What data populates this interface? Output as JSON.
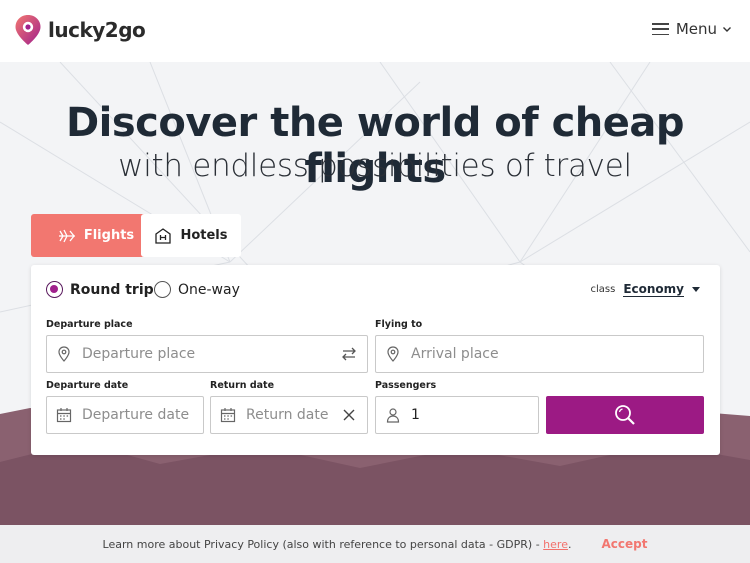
{
  "brand": {
    "name": "lucky2go",
    "accent": "#9c1a84",
    "coral": "#f27770"
  },
  "header": {
    "menu_label": "Menu"
  },
  "hero": {
    "headline": "Discover the world of cheap flights",
    "subline": "with endless possibilities of travel"
  },
  "tabs": [
    {
      "label": "Flights",
      "icon": "plane-icon",
      "active": true
    },
    {
      "label": "Hotels",
      "icon": "hotel-icon",
      "active": false
    }
  ],
  "search": {
    "trip_types": [
      {
        "label": "Round trip",
        "selected": true
      },
      {
        "label": "One-way",
        "selected": false
      }
    ],
    "class_label": "class",
    "class_value": "Economy",
    "departure_place": {
      "label": "Departure place",
      "placeholder": "Departure place"
    },
    "flying_to": {
      "label": "Flying to",
      "placeholder": "Arrival place"
    },
    "departure_date": {
      "label": "Departure date",
      "placeholder": "Departure date"
    },
    "return_date": {
      "label": "Return date",
      "placeholder": "Return date"
    },
    "passengers": {
      "label": "Passengers",
      "value": "1"
    }
  },
  "privacy": {
    "text": "Learn more about Privacy Policy (also with reference to personal data - GDPR) -",
    "link": "here",
    "after": ".",
    "accept": "Accept"
  }
}
